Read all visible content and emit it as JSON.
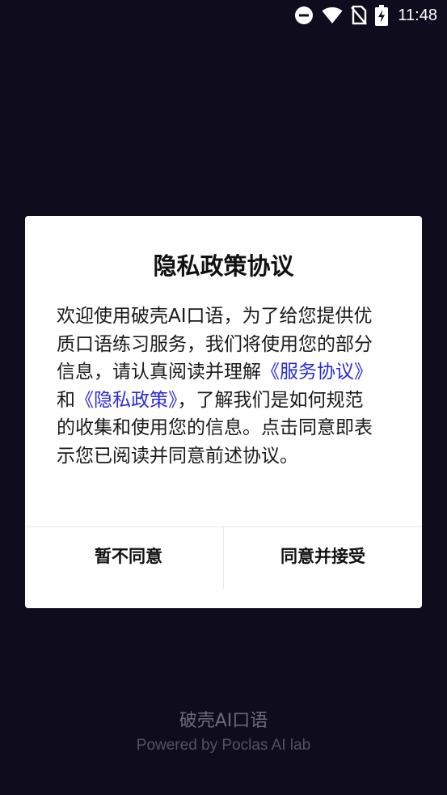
{
  "status_bar": {
    "time": "11:48",
    "icons": [
      "do-not-disturb-icon",
      "wifi-icon",
      "no-sim-icon",
      "battery-charging-icon"
    ]
  },
  "dialog": {
    "title": "隐私政策协议",
    "body_part1": "欢迎使用破壳AI口语，为了给您提供优质口语练习服务，我们将使用您的部分信息，请认真阅读并理解",
    "service_link": "《服务协议》",
    "body_part2": "和",
    "privacy_link": "《隐私政策》",
    "body_part3": "，了解我们是如何规范的收集和使用您的信息。点击同意即表示您已阅读并同意前述协议。",
    "decline_label": "暂不同意",
    "accept_label": "同意并接受",
    "link_color": "#2b2bdc"
  },
  "footer": {
    "app_name": "破壳AI口语",
    "powered_by": "Powered by Poclas AI lab"
  },
  "colors": {
    "background": "#0f0c1d",
    "dialog_background": "#ffffff"
  }
}
